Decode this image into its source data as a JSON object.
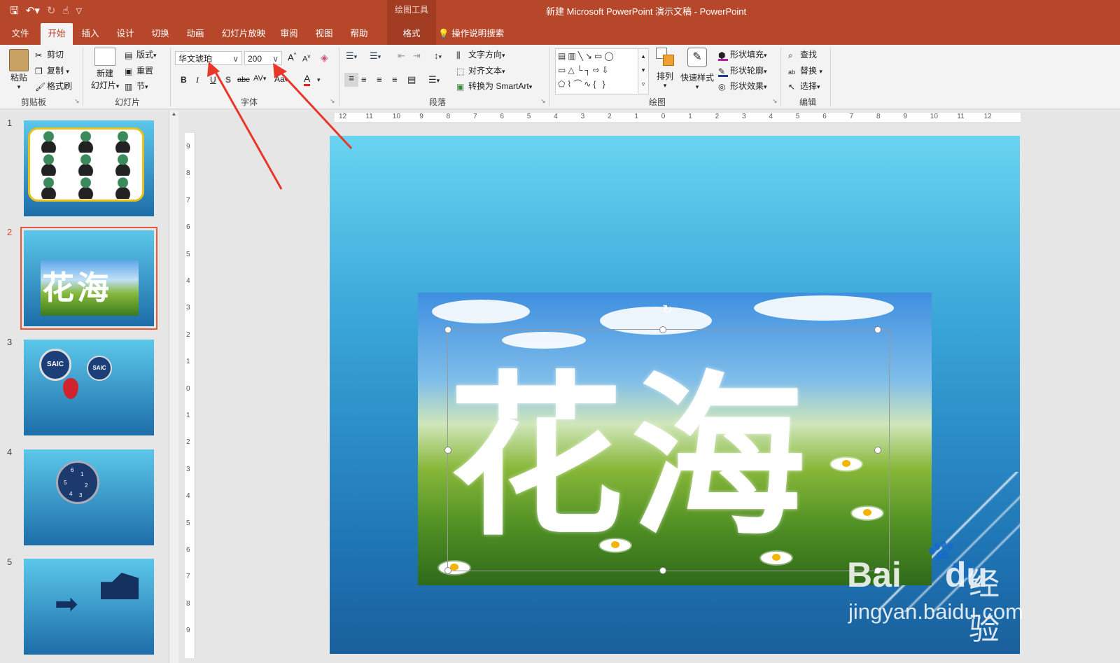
{
  "window": {
    "title": "新建 Microsoft PowerPoint 演示文稿  -  PowerPoint",
    "context_tool": "绘图工具"
  },
  "qat": {
    "save_icon": "save-icon",
    "undo_icon": "undo-icon",
    "redo_icon": "redo-icon",
    "touch_icon": "touch-mode-icon",
    "customize_icon": "customize-qat-icon"
  },
  "tabs": [
    "文件",
    "开始",
    "插入",
    "设计",
    "切换",
    "动画",
    "幻灯片放映",
    "审阅",
    "视图",
    "帮助",
    "格式"
  ],
  "active_tab": "开始",
  "tell_me": "操作说明搜索",
  "ribbon": {
    "clipboard": {
      "label": "剪贴板",
      "paste": "粘贴",
      "cut": "剪切",
      "copy": "复制",
      "format_painter": "格式刷"
    },
    "slides": {
      "label": "幻灯片",
      "new_slide": "新建",
      "new_slide2": "幻灯片",
      "layout": "版式",
      "reset": "重置",
      "section": "节"
    },
    "font": {
      "label": "字体",
      "font_name": "华文琥珀",
      "font_size": "200",
      "bold": "B",
      "italic": "I",
      "underline": "U",
      "shadow": "S",
      "strike": "abc",
      "spacing": "AV",
      "case": "Aa",
      "color": "A"
    },
    "paragraph": {
      "label": "段落",
      "text_direction": "文字方向",
      "align_text": "对齐文本",
      "smartart": "转换为 SmartArt"
    },
    "drawing": {
      "label": "绘图",
      "arrange": "排列",
      "quick_styles": "快速样式",
      "shape_fill": "形状填充",
      "shape_outline": "形状轮廓",
      "shape_effects": "形状效果"
    },
    "editing": {
      "label": "编辑",
      "find": "查找",
      "replace": "替换",
      "select": "选择"
    }
  },
  "slides": [
    {
      "num": "1"
    },
    {
      "num": "2",
      "selected": true
    },
    {
      "num": "3"
    },
    {
      "num": "4"
    },
    {
      "num": "5"
    }
  ],
  "slide_content": {
    "big_text": "花海",
    "thumb2_text": "花海",
    "thumb3_badge": "SAIC",
    "thumb4_numbers": [
      "6",
      "1",
      "2",
      "3",
      "4",
      "5"
    ]
  },
  "hruler_labels": [
    "12",
    "11",
    "10",
    "9",
    "8",
    "7",
    "6",
    "5",
    "4",
    "3",
    "2",
    "1",
    "0",
    "1",
    "2",
    "3",
    "4",
    "5",
    "6",
    "7",
    "8",
    "9",
    "10",
    "11",
    "12"
  ],
  "vruler_labels": [
    "9",
    "8",
    "7",
    "6",
    "5",
    "4",
    "3",
    "2",
    "1",
    "0",
    "1",
    "2",
    "3",
    "4",
    "5",
    "6",
    "7",
    "8",
    "9"
  ],
  "watermark": {
    "brand": "Bai",
    "brand2": "du",
    "chinese": "经验",
    "url": "jingyan.baidu.com"
  },
  "colors": {
    "accent": "#b7472a",
    "slide_top": "#69d5f1",
    "slide_bottom": "#195f9c",
    "arrow": "#e8372a"
  }
}
